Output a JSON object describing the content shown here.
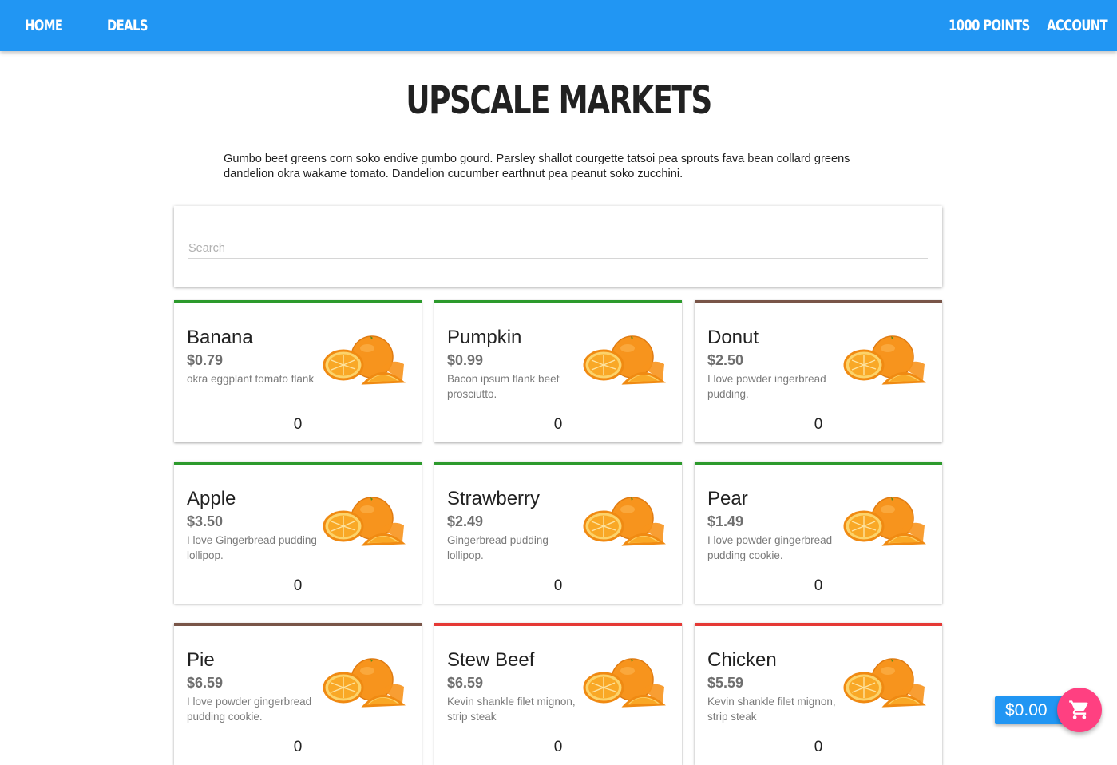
{
  "nav": {
    "home": "HOME",
    "deals": "DEALS",
    "points": "1000 POINTS",
    "account": "ACCOUNT"
  },
  "header": {
    "title": "UPSCALE MARKETS",
    "intro": "Gumbo beet greens corn soko endive gumbo gourd. Parsley shallot courgette tatsoi pea sprouts fava bean collard greens dandelion okra wakame tomato. Dandelion cucumber earthnut pea peanut soko zucchini."
  },
  "search": {
    "placeholder": "Search",
    "value": ""
  },
  "colors": {
    "primary": "#2196f3",
    "accent": "#ff4081",
    "green": "#2c9a2c",
    "brown": "#795548",
    "red": "#e53935"
  },
  "products": [
    {
      "name": "Banana",
      "price": "$0.79",
      "desc": "okra eggplant tomato flank",
      "qty": "0",
      "accent": "#2c9a2c",
      "image": "orange-fruit-image"
    },
    {
      "name": "Pumpkin",
      "price": "$0.99",
      "desc": "Bacon ipsum flank beef prosciutto.",
      "qty": "0",
      "accent": "#2c9a2c",
      "image": "orange-fruit-image"
    },
    {
      "name": "Donut",
      "price": "$2.50",
      "desc": "I love powder ingerbread pudding.",
      "qty": "0",
      "accent": "#795548",
      "image": "orange-fruit-image"
    },
    {
      "name": "Apple",
      "price": "$3.50",
      "desc": "I love Gingerbread pudding lollipop.",
      "qty": "0",
      "accent": "#2c9a2c",
      "image": "orange-fruit-image"
    },
    {
      "name": "Strawberry",
      "price": "$2.49",
      "desc": "Gingerbread pudding lollipop.",
      "qty": "0",
      "accent": "#2c9a2c",
      "image": "orange-fruit-image"
    },
    {
      "name": "Pear",
      "price": "$1.49",
      "desc": "I love powder gingerbread pudding cookie.",
      "qty": "0",
      "accent": "#2c9a2c",
      "image": "orange-fruit-image"
    },
    {
      "name": "Pie",
      "price": "$6.59",
      "desc": "I love powder gingerbread pudding cookie.",
      "qty": "0",
      "accent": "#795548",
      "image": "orange-fruit-image"
    },
    {
      "name": "Stew Beef",
      "price": "$6.59",
      "desc": "Kevin shankle filet mignon, strip steak",
      "qty": "0",
      "accent": "#e53935",
      "image": "orange-fruit-image"
    },
    {
      "name": "Chicken",
      "price": "$5.59",
      "desc": "Kevin shankle filet mignon, strip steak",
      "qty": "0",
      "accent": "#e53935",
      "image": "orange-fruit-image"
    }
  ],
  "cart": {
    "total": "$0.00",
    "icon": "shopping-cart-icon"
  }
}
